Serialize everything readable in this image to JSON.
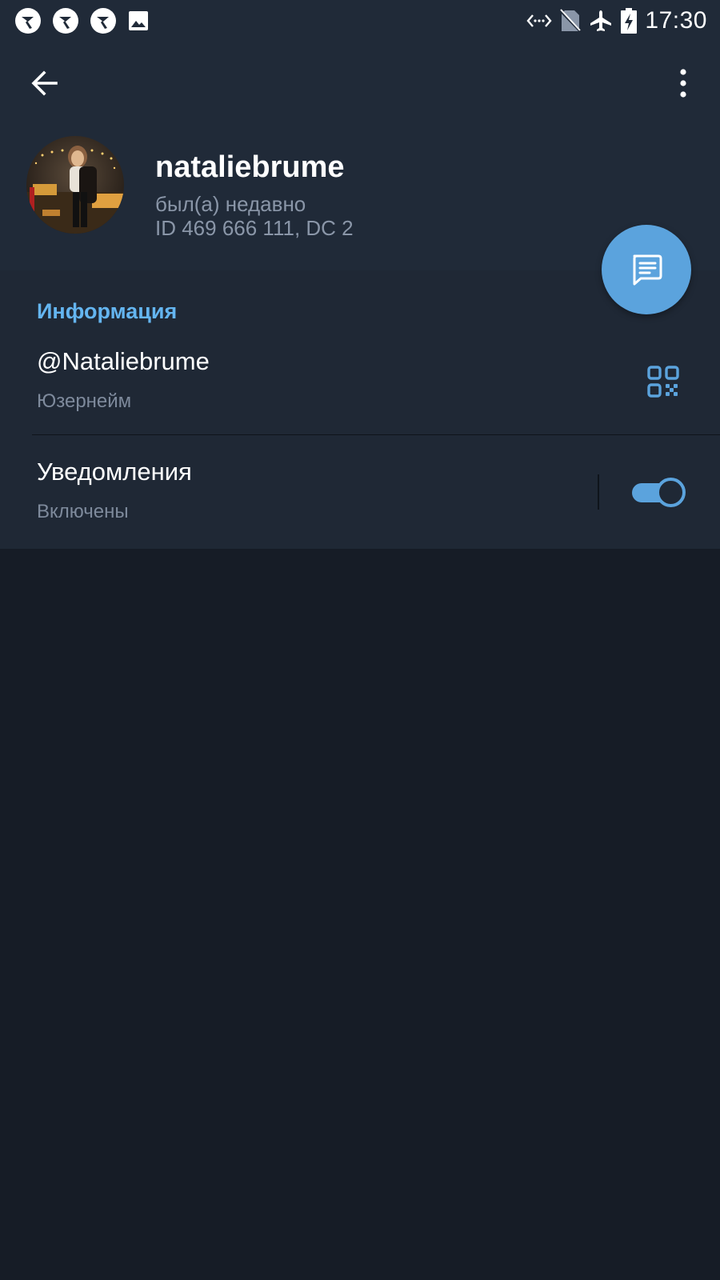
{
  "status_bar": {
    "time": "17:30",
    "left_icons": [
      "app-notification-icon",
      "app-notification-icon",
      "app-notification-icon",
      "image-icon"
    ],
    "right_icons": [
      "data-saver-icon",
      "no-sim-icon",
      "airplane-mode-icon",
      "battery-charging-icon"
    ]
  },
  "header": {
    "name": "nataliebrume",
    "status": "был(а) недавно",
    "id_line": "ID 469 666 111, DC 2"
  },
  "info": {
    "section_title": "Информация",
    "username_value": "@Nataliebrume",
    "username_label": "Юзернейм",
    "notifications_title": "Уведомления",
    "notifications_value": "Включены",
    "notifications_enabled": true
  },
  "colors": {
    "accent": "#5ba3dd",
    "section_title": "#64b5f0",
    "header_bg": "#202a38",
    "page_bg": "#161c26"
  }
}
